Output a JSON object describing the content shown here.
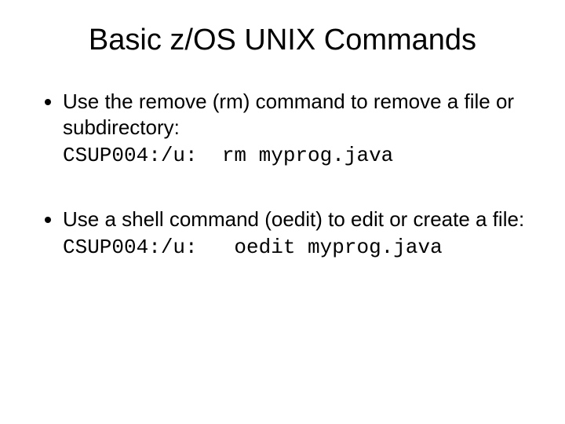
{
  "title": "Basic z/OS UNIX Commands",
  "bullets": [
    {
      "text": "Use the remove (rm) command to remove a file or subdirectory:",
      "command": "CSUP004:/u:  rm myprog.java"
    },
    {
      "text": "Use a shell command (oedit) to edit or create a file:",
      "command": "CSUP004:/u:   oedit myprog.java"
    }
  ]
}
